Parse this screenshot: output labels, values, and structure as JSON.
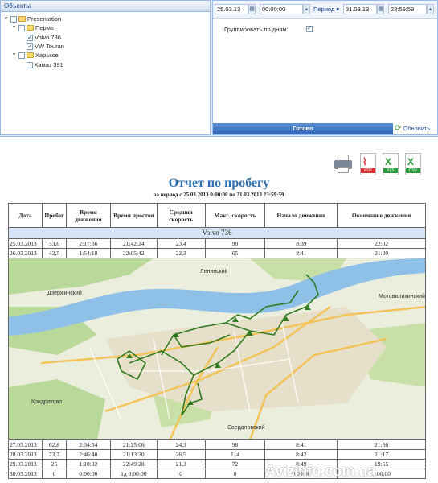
{
  "tree": {
    "header": "Объекты",
    "items": [
      {
        "label": "Presentation",
        "checked": false,
        "folder": true,
        "level": 0
      },
      {
        "label": "Пермь",
        "checked": false,
        "folder": true,
        "level": 1
      },
      {
        "label": "Volvo 736",
        "checked": true,
        "folder": false,
        "level": 2
      },
      {
        "label": "VW Touran",
        "checked": true,
        "folder": false,
        "level": 2
      },
      {
        "label": "Харьков",
        "checked": false,
        "folder": true,
        "level": 1
      },
      {
        "label": "Камаз 391",
        "checked": false,
        "folder": false,
        "level": 2
      }
    ]
  },
  "filters": {
    "date_from": "25.03.13",
    "time_from": "00:00:00",
    "period_label": "Период",
    "date_to": "31.03.13",
    "time_to": "23:59:59",
    "group_by_days_label": "Группировать по дням:",
    "group_by_days": true,
    "apply_label": "Готово",
    "refresh_label": "Обновить"
  },
  "export": {
    "pdf_tag": "PDF",
    "xls_tag": "XLS",
    "csv_tag": "CSV"
  },
  "report": {
    "title": "Отчет по пробегу",
    "subtitle": "за период с 25.03.2013 0:00:00 по 31.03.2013 23:59:59",
    "columns": [
      "Дата",
      "Пробег",
      "Время движения",
      "Время простоя",
      "Средняя скорость",
      "Макс. скорость",
      "Начало движения",
      "Окончание движения"
    ],
    "group_name": "Volvo 736",
    "rows_before_map": [
      [
        "25.03.2013",
        "53,6",
        "2:17:36",
        "21:42:24",
        "23,4",
        "90",
        "8:39",
        "22:02"
      ],
      [
        "26.03.2013",
        "42,5",
        "1:54:18",
        "22:05:42",
        "22,3",
        "65",
        "8:41",
        "21:20"
      ]
    ],
    "rows_after_map": [
      [
        "27.03.2013",
        "62,8",
        "2:34:54",
        "21:25:06",
        "24,3",
        "98",
        "8:41",
        "21:56"
      ],
      [
        "28.03.2013",
        "73,7",
        "2:46:40",
        "21:13:20",
        "26,5",
        "114",
        "8:42",
        "21:17"
      ],
      [
        "29.03.2013",
        "25",
        "1:10:32",
        "22:49:28",
        "21,3",
        "72",
        "8:49",
        "19:55"
      ],
      [
        "30.03.2013",
        "0",
        "0:00:00",
        "1д 0:00:00",
        "0",
        "0",
        "0:00:00",
        "0:00:00"
      ]
    ]
  },
  "map": {
    "labels": {
      "dzerzhinsky": "Дзержинский",
      "leninsky": "Ленинский",
      "motovilikhinsky": "Мотовилихинский",
      "kondratovo": "Кондратово",
      "sverdlovsky": "Свердловский"
    }
  },
  "watermark": "AvizInfo.com.ua",
  "colors": {
    "accent": "#2c6fb0",
    "river": "#7fb6e3",
    "route": "#2f7a1f"
  }
}
